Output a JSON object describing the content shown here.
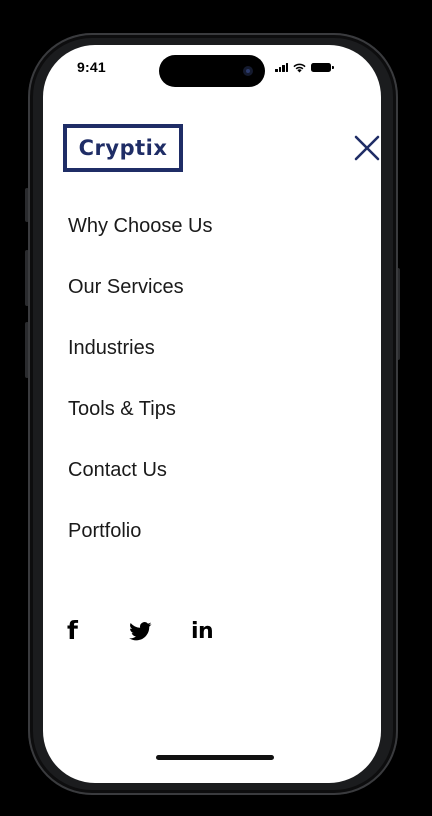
{
  "status_bar": {
    "time": "9:41"
  },
  "brand": {
    "logo_text": "Cryptix",
    "accent_color": "#1f2d66"
  },
  "menu": {
    "items": [
      {
        "label": "Why Choose Us"
      },
      {
        "label": "Our Services"
      },
      {
        "label": "Industries"
      },
      {
        "label": "Tools & Tips"
      },
      {
        "label": "Contact Us"
      },
      {
        "label": "Portfolio"
      }
    ],
    "close_icon": "close-icon"
  },
  "socials": {
    "facebook": {
      "glyph": "f",
      "icon": "facebook-icon"
    },
    "twitter": {
      "icon": "twitter-icon"
    },
    "linkedin": {
      "glyph": "in",
      "icon": "linkedin-icon"
    }
  }
}
